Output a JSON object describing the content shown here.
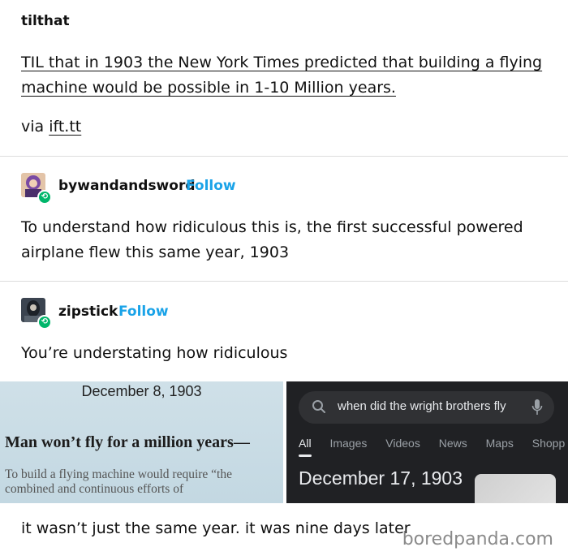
{
  "original_post": {
    "blog_name": "tilthat",
    "title": "TIL that in 1903 the New York Times predicted that building a flying machine would be possible in 1-10 Million years.",
    "via_prefix": "via",
    "via_link": "ift.tt"
  },
  "reblogs": [
    {
      "username": "bywandandsword",
      "follow_label": "Follow",
      "text": "To understand how ridiculous this is, the first successful powered airplane flew this same year, 1903"
    },
    {
      "username": "zipstick",
      "follow_label": "Follow",
      "text": "You’re understating how ridiculous"
    }
  ],
  "newspaper_image": {
    "date": "December 8, 1903",
    "headline": "Man won’t fly for a million years—",
    "subtext": "To build a flying machine would require “the combined and continuous efforts of"
  },
  "google_image": {
    "query": "when did the wright brothers fly",
    "tabs": [
      "All",
      "Images",
      "Videos",
      "News",
      "Maps",
      "Shopp"
    ],
    "active_tab": "All",
    "answer": "December 17, 1903"
  },
  "final_text": "it wasn’t just the same year. it was nine days later",
  "watermark": "boredpanda.com",
  "colors": {
    "follow": "#1aa3e8",
    "reblog_badge": "#00b66b",
    "google_bg": "#202124"
  }
}
